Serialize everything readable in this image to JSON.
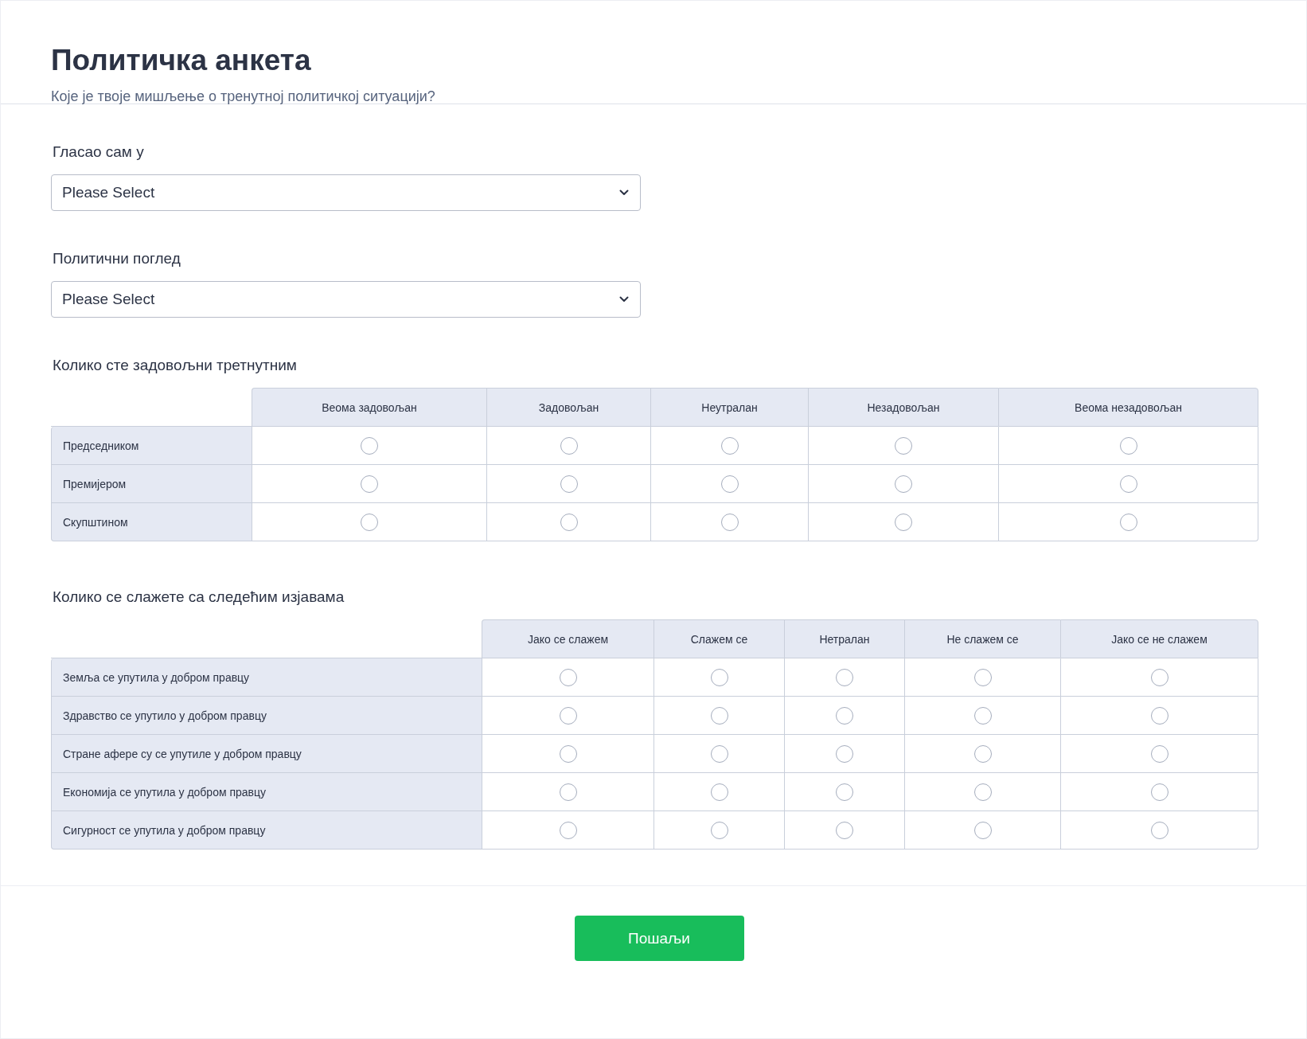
{
  "header": {
    "title": "Политичка анкета",
    "subtitle": "Које је твоје мишљење о тренутној политичкој ситуацији?"
  },
  "fields": [
    {
      "kind": "dropdown",
      "label": "Гласао сам у",
      "placeholder": "Please Select"
    },
    {
      "kind": "dropdown",
      "label": "Политични поглед",
      "placeholder": "Please Select"
    },
    {
      "kind": "matrix",
      "label": "Колико сте задовољни третнутним",
      "columns": [
        "Веома задовољан",
        "Задовољан",
        "Неутралан",
        "Незадовољан",
        "Веома незадовољан"
      ],
      "rows": [
        {
          "label": "Председником",
          "cells": [
            {
              "selected": false
            },
            {
              "selected": false
            },
            {
              "selected": false
            },
            {
              "selected": false
            },
            {
              "selected": false
            }
          ]
        },
        {
          "label": "Премијером",
          "cells": [
            {
              "selected": false
            },
            {
              "selected": false
            },
            {
              "selected": false
            },
            {
              "selected": false
            },
            {
              "selected": false
            }
          ]
        },
        {
          "label": "Скупштином",
          "cells": [
            {
              "selected": false
            },
            {
              "selected": false
            },
            {
              "selected": false
            },
            {
              "selected": false
            },
            {
              "selected": false
            }
          ]
        }
      ]
    },
    {
      "kind": "matrix",
      "label": "Колико се слажете са следећим изјавама",
      "columns": [
        "Јако се слажем",
        "Слажем се",
        "Нетралан",
        "Не слажем се",
        "Јако се не слажем"
      ],
      "rows": [
        {
          "label": "Земља се упутила у добром правцу",
          "cells": [
            {
              "selected": false
            },
            {
              "selected": false
            },
            {
              "selected": false
            },
            {
              "selected": false
            },
            {
              "selected": false
            }
          ]
        },
        {
          "label": "Здравство се упутило у добром правцу",
          "cells": [
            {
              "selected": false
            },
            {
              "selected": false
            },
            {
              "selected": false
            },
            {
              "selected": false
            },
            {
              "selected": false
            }
          ]
        },
        {
          "label": "Стране афере су се упутиле у добром правцу",
          "cells": [
            {
              "selected": false
            },
            {
              "selected": false
            },
            {
              "selected": false
            },
            {
              "selected": false
            },
            {
              "selected": false
            }
          ]
        },
        {
          "label": "Економија се упутила у добром правцу",
          "cells": [
            {
              "selected": false
            },
            {
              "selected": false
            },
            {
              "selected": false
            },
            {
              "selected": false
            },
            {
              "selected": false
            }
          ]
        },
        {
          "label": "Сигурност се упутила у добром правцу",
          "cells": [
            {
              "selected": false
            },
            {
              "selected": false
            },
            {
              "selected": false
            },
            {
              "selected": false
            },
            {
              "selected": false
            }
          ]
        }
      ]
    }
  ],
  "submit": {
    "label": "Пошаљи"
  }
}
